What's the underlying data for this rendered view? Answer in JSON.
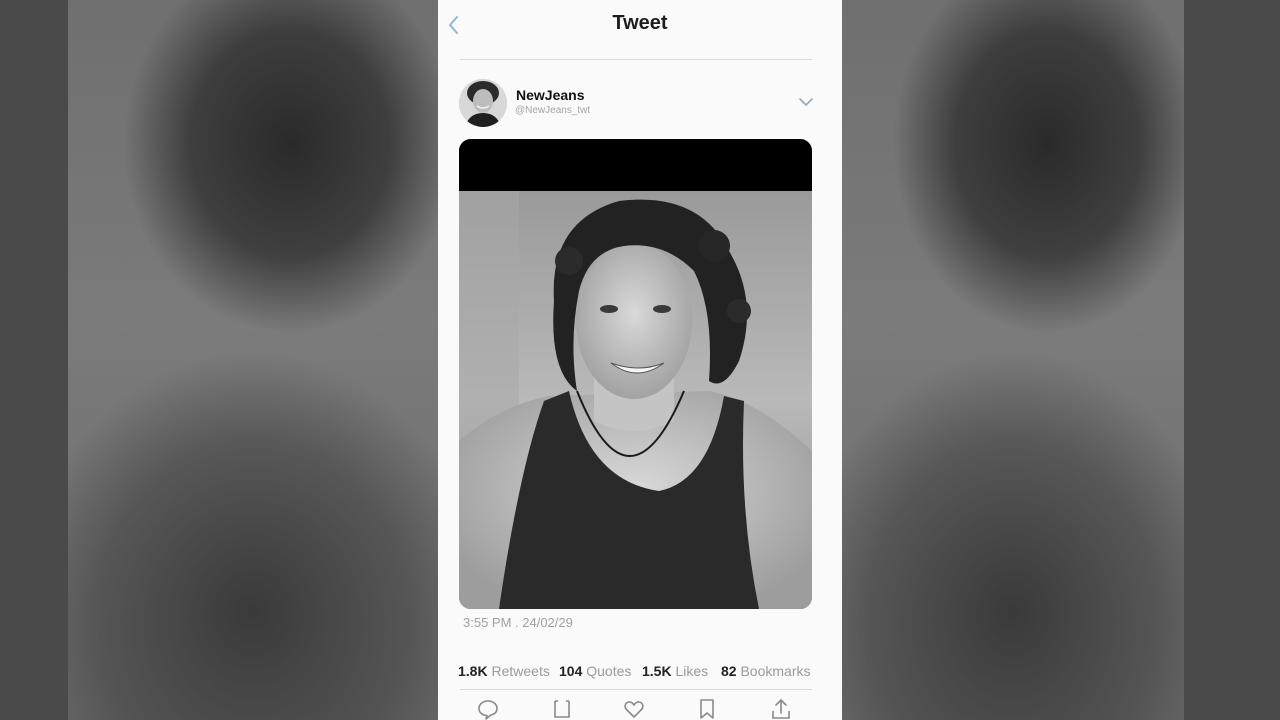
{
  "header": {
    "title": "Tweet"
  },
  "tweet": {
    "display_name": "NewJeans",
    "handle": "@NewJeans_twt",
    "timestamp": "3:55 PM . 24/02/29"
  },
  "stats": {
    "retweets_count": "1.8K",
    "retweets_label": "Retweets",
    "quotes_count": "104",
    "quotes_label": "Quotes",
    "likes_count": "1.5K",
    "likes_label": "Likes",
    "bookmarks_count": "82",
    "bookmarks_label": "Bookmarks"
  },
  "icons": {
    "back": "chevron-left-icon",
    "more": "chevron-down-icon",
    "reply": "comment-icon",
    "retweet": "retweet-icon",
    "like": "heart-icon",
    "bookmark": "bookmark-icon",
    "share": "share-icon"
  },
  "colors": {
    "accent": "#8fb6d8",
    "icon_gray": "#8a8a8a",
    "text_primary": "#1d1d1d",
    "text_secondary": "#9a9a9a"
  }
}
